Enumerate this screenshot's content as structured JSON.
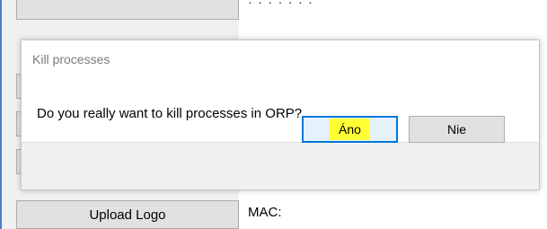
{
  "background": {
    "upload_logo_label": "Upload Logo",
    "mac_label": "MAC:",
    "partial_text_top": "· · · · ·   · ·",
    "partial_text_mid": "· · · ·  · · ·"
  },
  "dialog": {
    "title": "Kill processes",
    "message": "Do you really want to kill processes in ORP?",
    "buttons": {
      "yes_label": "Áno",
      "no_label": "Nie"
    }
  },
  "colors": {
    "accent_focus": "#0078d7",
    "highlight": "#ffff33"
  }
}
